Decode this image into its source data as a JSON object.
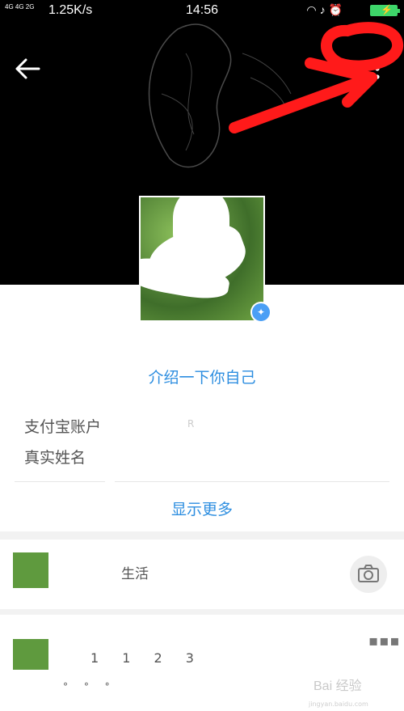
{
  "status_bar": {
    "network": "4G 4G 2G",
    "speed": "1.25K/s",
    "time": "14:56",
    "icons": [
      "headset-icon",
      "bell-off-icon",
      "alarm-icon"
    ],
    "battery_color": "#3ed66a"
  },
  "header": {
    "back_icon": "arrow-left-icon",
    "more_icon": "more-vertical-icon",
    "annotation_color": "#ff1a1a"
  },
  "profile": {
    "intro_link": "介绍一下你自己",
    "fields": [
      {
        "label": "支付宝账户",
        "value": "R"
      },
      {
        "label": "真实姓名",
        "value": ""
      }
    ],
    "show_more": "显示更多",
    "accent_color": "#2d8ee0"
  },
  "life": {
    "label_fragment": "生活",
    "camera_icon": "camera-icon"
  },
  "album": {
    "counter": "1 1 2 3",
    "circles": "° ° °",
    "more_icon": "more-horizontal-icon"
  },
  "watermark": {
    "text": "Bai 经验",
    "sub": "jingyan.baidu.com"
  }
}
